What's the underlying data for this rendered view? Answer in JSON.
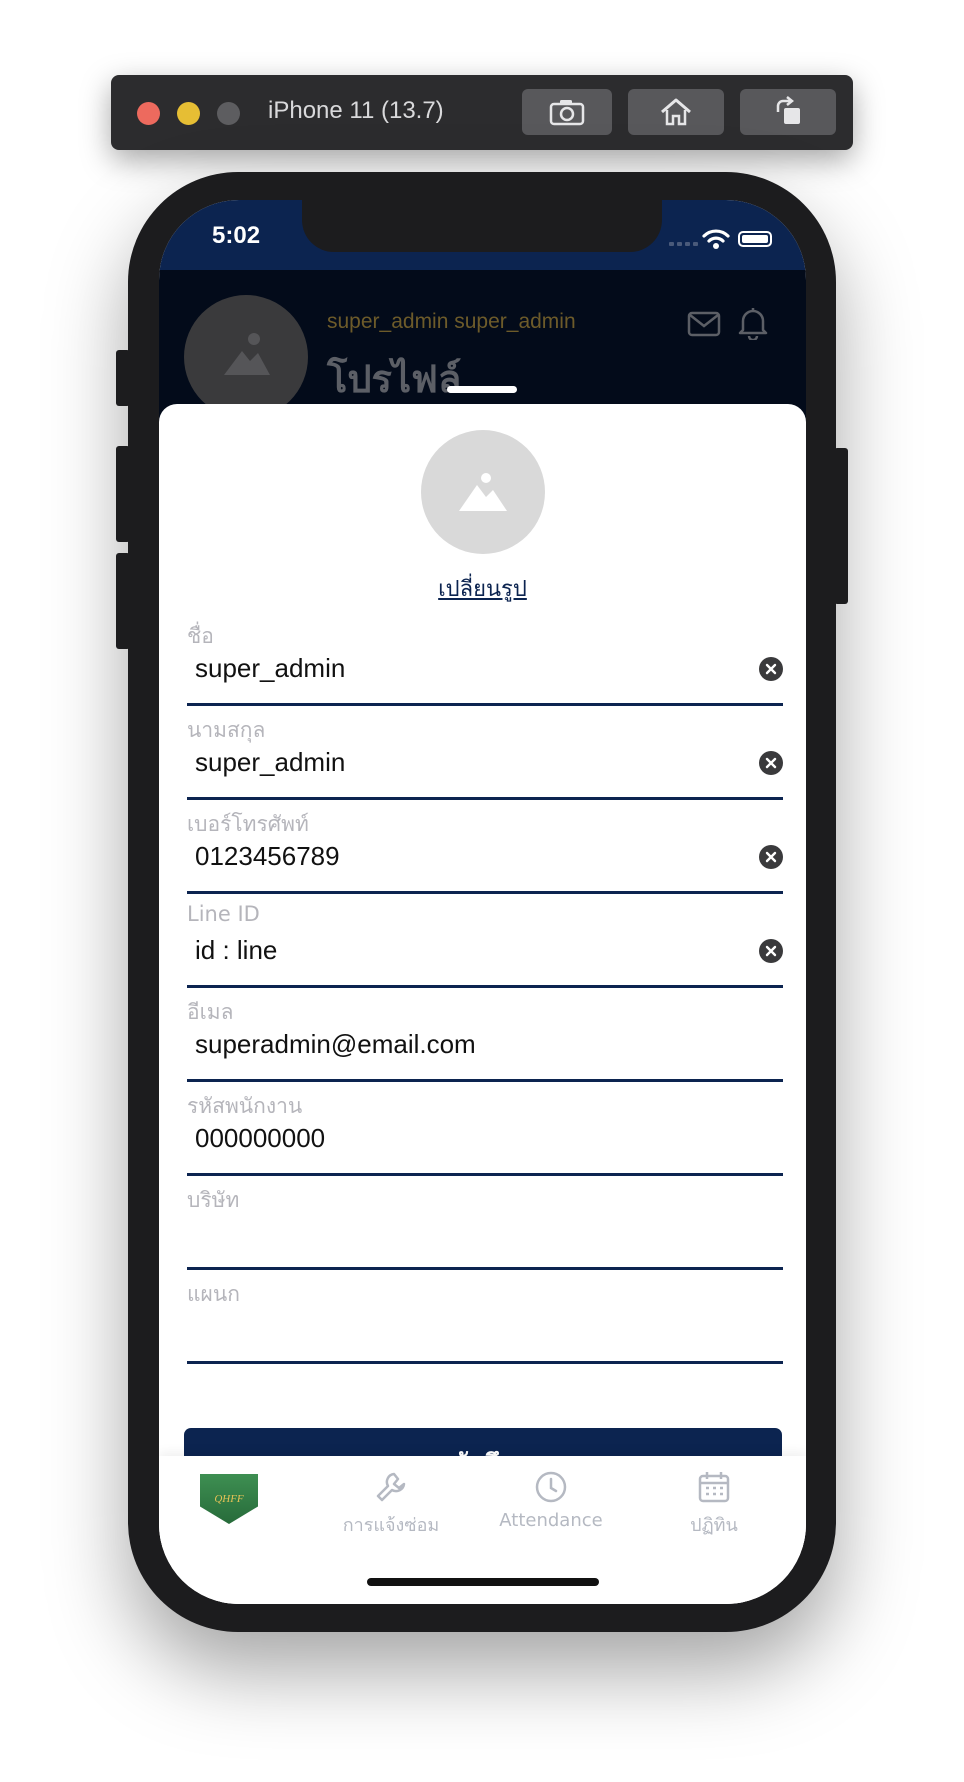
{
  "simulator": {
    "title": "iPhone 11 (13.7)",
    "buttons": [
      "screenshot-icon",
      "home-icon",
      "rotate-icon"
    ]
  },
  "status_bar": {
    "time": "5:02"
  },
  "header": {
    "user_name": "super_admin super_admin",
    "title": "โปรไฟล์",
    "icons": [
      "mail-icon",
      "bell-icon"
    ]
  },
  "profile": {
    "change_photo": "เปลี่ยนรูป"
  },
  "fields": [
    {
      "label": "ชื่อ",
      "value": "super_admin",
      "clearable": true
    },
    {
      "label": "นามสกุล",
      "value": "super_admin",
      "clearable": true
    },
    {
      "label": "เบอร์โทรศัพท์",
      "value": "0123456789",
      "clearable": true
    },
    {
      "label": "Line ID",
      "value": "id : line",
      "clearable": true
    },
    {
      "label": "อีเมล",
      "value": "superadmin@email.com",
      "clearable": false
    },
    {
      "label": "รหัสพนักงาน",
      "value": "000000000",
      "clearable": false
    },
    {
      "label": "บริษัท",
      "value": "",
      "clearable": false
    },
    {
      "label": "แผนก",
      "value": "",
      "clearable": false
    }
  ],
  "save_button": "บันทึก",
  "tabbar": {
    "logo_text": "QHFF",
    "tabs": [
      {
        "label": "การแจ้งซ่อม",
        "icon": "wrench-icon"
      },
      {
        "label": "Attendance",
        "icon": "clock-icon"
      },
      {
        "label": "ปฏิทิน",
        "icon": "calendar-icon"
      }
    ]
  },
  "colors": {
    "primary": "#0c2450",
    "label_gray": "#b5b5bb",
    "tab_gray": "#b5b9c2"
  }
}
